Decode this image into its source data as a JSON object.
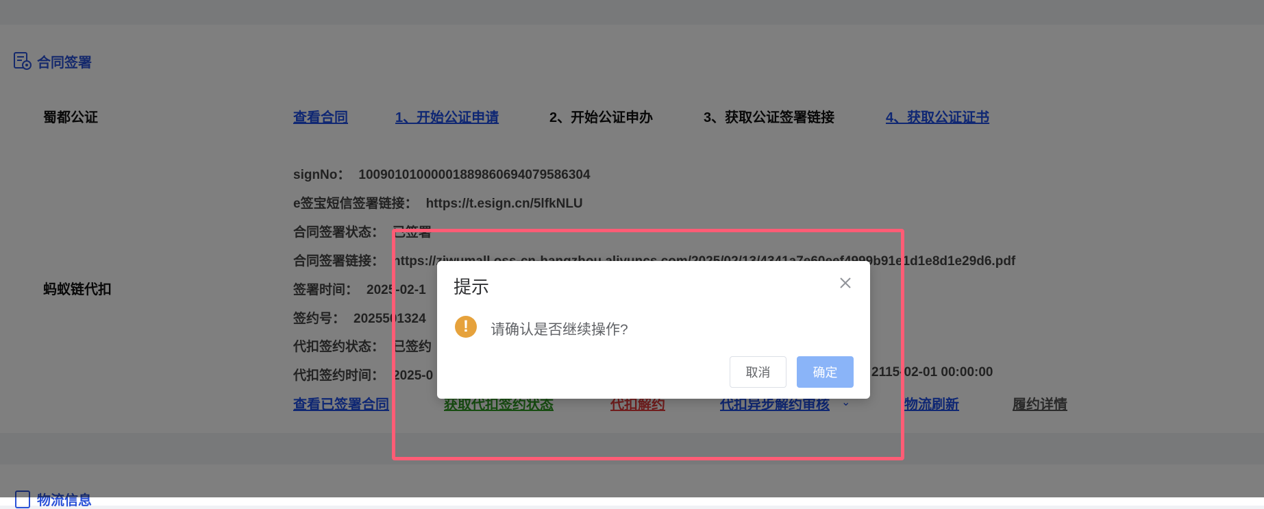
{
  "section": {
    "title": "合同签署",
    "icon": "contract-seal-icon",
    "next_title": "物流信息"
  },
  "notary": {
    "label": "蜀都公证",
    "links": [
      "查看合同",
      "1、开始公证申请",
      "2、开始公证申办",
      "3、获取公证签署链接",
      "4、获取公证证书"
    ]
  },
  "deduct": {
    "label": "蚂蚁链代扣",
    "rows": [
      {
        "k": "signNo：",
        "v": "1009010100000188986069407958630​4"
      },
      {
        "k": "e签宝短信签署链接：",
        "v": "https://t.esign.cn/5lfkNLU"
      },
      {
        "k": "合同签署状态：",
        "v": "已签署"
      },
      {
        "k": "合同签署链接：",
        "v": "https://ziwumall.oss-cn-hangzhou.aliyuncs.com/2025/02/13/4341a7e60eef4999b91e1d1e8d1e29d6.pdf"
      },
      {
        "k": "签署时间：",
        "v": "2025-02-1"
      },
      {
        "k": "签约号：",
        "v": "2025501324"
      },
      {
        "k": "代扣签约状态：",
        "v": "已签约"
      },
      {
        "k": "代扣签约时间：",
        "v": "2025-0"
      }
    ],
    "valid_until_tail": "2115-02-01 00:00:00",
    "actions": [
      "查看已签署合同",
      "获取代扣签约状态",
      "代扣解约",
      "代扣异步解约审核",
      "物流刷新",
      "履约详情"
    ]
  },
  "dialog": {
    "title": "提示",
    "message": "请确认是否继续操作?",
    "cancel": "取消",
    "confirm": "确定",
    "confirm_color": "#8ab4f8",
    "warn_color": "#e6a23c"
  },
  "highlight_color": "#ff5c75"
}
